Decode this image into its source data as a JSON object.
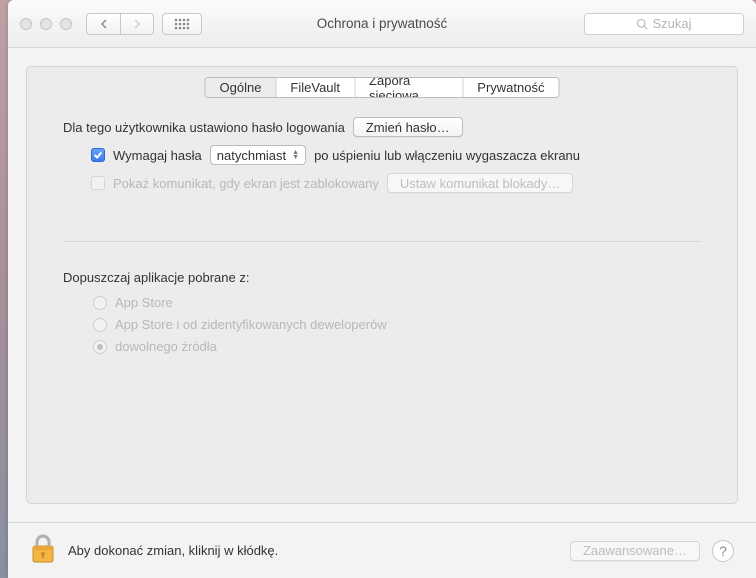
{
  "window": {
    "title": "Ochrona i prywatność"
  },
  "search": {
    "placeholder": "Szukaj"
  },
  "tabs": {
    "general": "Ogólne",
    "filevault": "FileVault",
    "firewall": "Zapora sieciowa",
    "privacy": "Prywatność"
  },
  "general": {
    "login_pwd_set": "Dla tego użytkownika ustawiono hasło logowania",
    "change_password": "Zmień hasło…",
    "require_password": "Wymagaj hasła",
    "require_delay": "natychmiast",
    "after_sleep": "po uśpieniu lub włączeniu wygaszacza ekranu",
    "show_message": "Pokaż komunikat, gdy ekran jest zablokowany",
    "set_lock_message": "Ustaw komunikat blokady…",
    "allow_apps_header": "Dopuszczaj aplikacje pobrane z:",
    "radio_appstore": "App Store",
    "radio_identified": "App Store i od zidentyfikowanych deweloperów",
    "radio_anywhere": "dowolnego źródła"
  },
  "footer": {
    "lock_text": "Aby dokonać zmian, kliknij w kłódkę.",
    "advanced": "Zaawansowane…"
  }
}
